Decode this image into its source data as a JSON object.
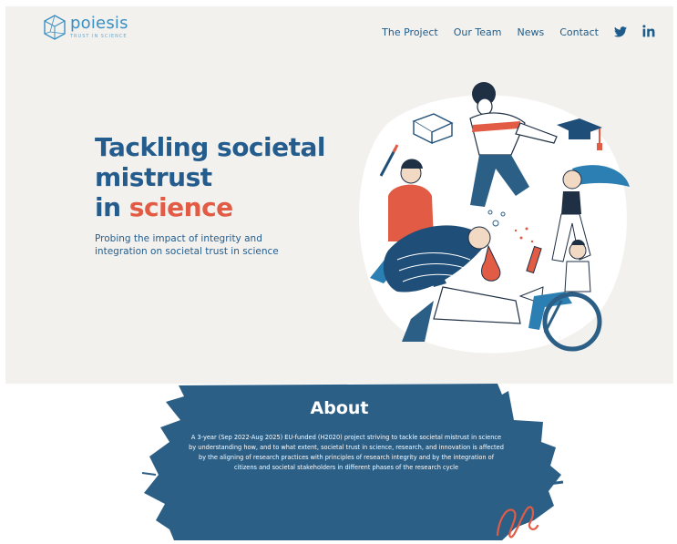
{
  "logo": {
    "name": "poiesis",
    "tagline": "TRUST IN SCIENCE"
  },
  "nav": {
    "items": [
      "The Project",
      "Our Team",
      "News",
      "Contact"
    ],
    "social": [
      "twitter-icon",
      "linkedin-icon"
    ]
  },
  "hero": {
    "title_line1": "Tackling societal",
    "title_line2": "mistrust",
    "title_line3_prefix": "in ",
    "title_line3_accent": "science",
    "subtitle": "Probing the impact of integrity and integration on societal trust in science"
  },
  "about": {
    "title": "About",
    "text": "A 3-year (Sep 2022-Aug 2025) EU-funded (H2020) project striving to tackle societal mistrust in science by understanding how, and to what extent, societal trust in science, research, and innovation is affected by the aligning of research practices with principles of research integrity and by the integration of citizens and societal stakeholders in different phases of the research cycle"
  },
  "colors": {
    "primary": "#245d8d",
    "accent": "#e25b45",
    "background": "#f3f1ee",
    "brush": "#2c5f86"
  }
}
